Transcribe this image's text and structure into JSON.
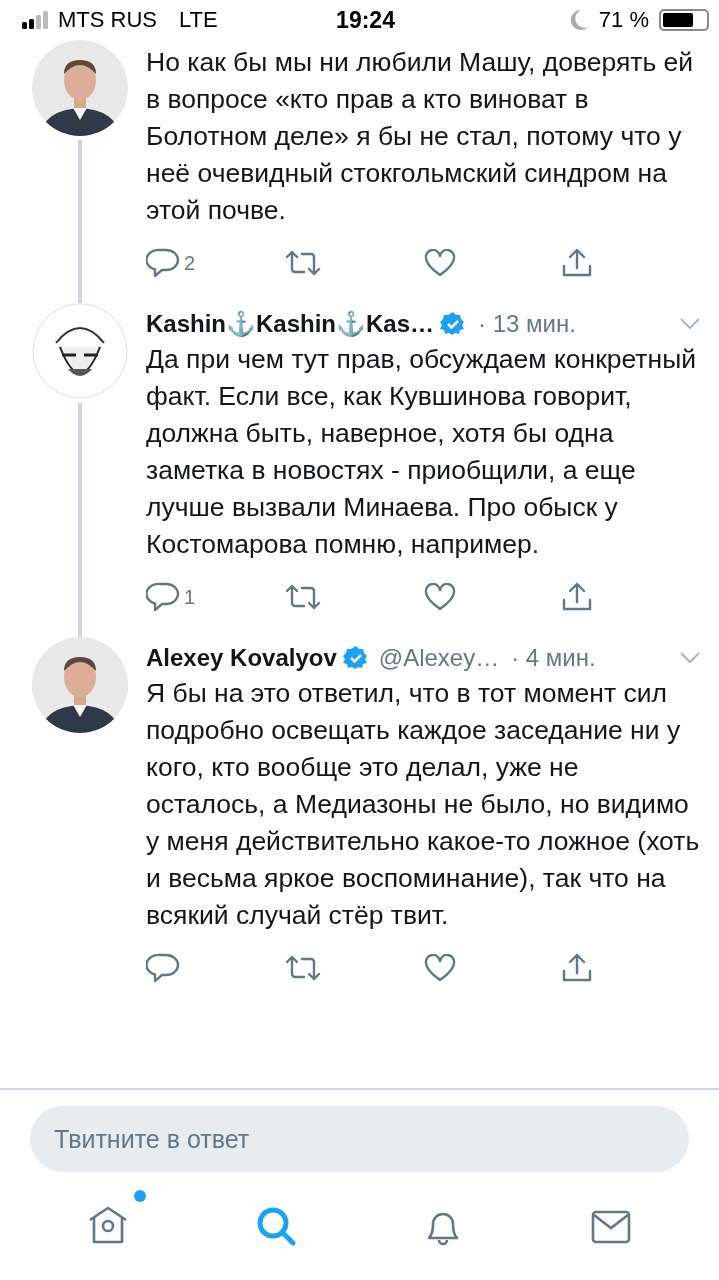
{
  "status_bar": {
    "carrier": "MTS RUS",
    "network": "LTE",
    "time": "19:24",
    "battery": "71 %"
  },
  "tweets": [
    {
      "text": "Но как бы мы ни любили Машу, доверять ей в вопросе «кто прав а кто виноват в Болотном деле» я бы не стал, потому что у неё очевидный стокгольмский синдром на этой почве.",
      "reply_count": "2"
    },
    {
      "name": "Kashin⚓Kashin⚓Kas…",
      "verified": true,
      "time": "· 13 мин.",
      "text": "Да при чем тут прав, обсуждаем конкретный факт. Если все, как Кувшинова говорит, должна быть, наверное, хотя бы одна заметка в новостях - приобщили, а еще лучше вызвали Минаева. Про обыск у Костомарова помню, например.",
      "reply_count": "1",
      "kind": "sketch"
    },
    {
      "name": "Alexey Kovalyov",
      "verified": true,
      "handle": "@Alexey…",
      "time": "· 4 мин.",
      "text": "Я бы на это ответил, что в тот момент сил подробно освещать каждое заседание ни у кого, кто вообще это делал, уже не осталось, а Медиазоны не было, но видимо у меня действительно какое-то ложное (хоть и весьма яркое воспоминание), так что на всякий случай стёр твит."
    }
  ],
  "reply_field": {
    "placeholder": "Твитните в ответ"
  },
  "tab_bar": [
    {
      "kind": "home",
      "selected": false,
      "badge": true
    },
    {
      "kind": "search",
      "selected": true,
      "badge": false
    },
    {
      "kind": "notifications",
      "selected": false,
      "badge": false
    },
    {
      "kind": "messages",
      "selected": false,
      "badge": false
    }
  ]
}
